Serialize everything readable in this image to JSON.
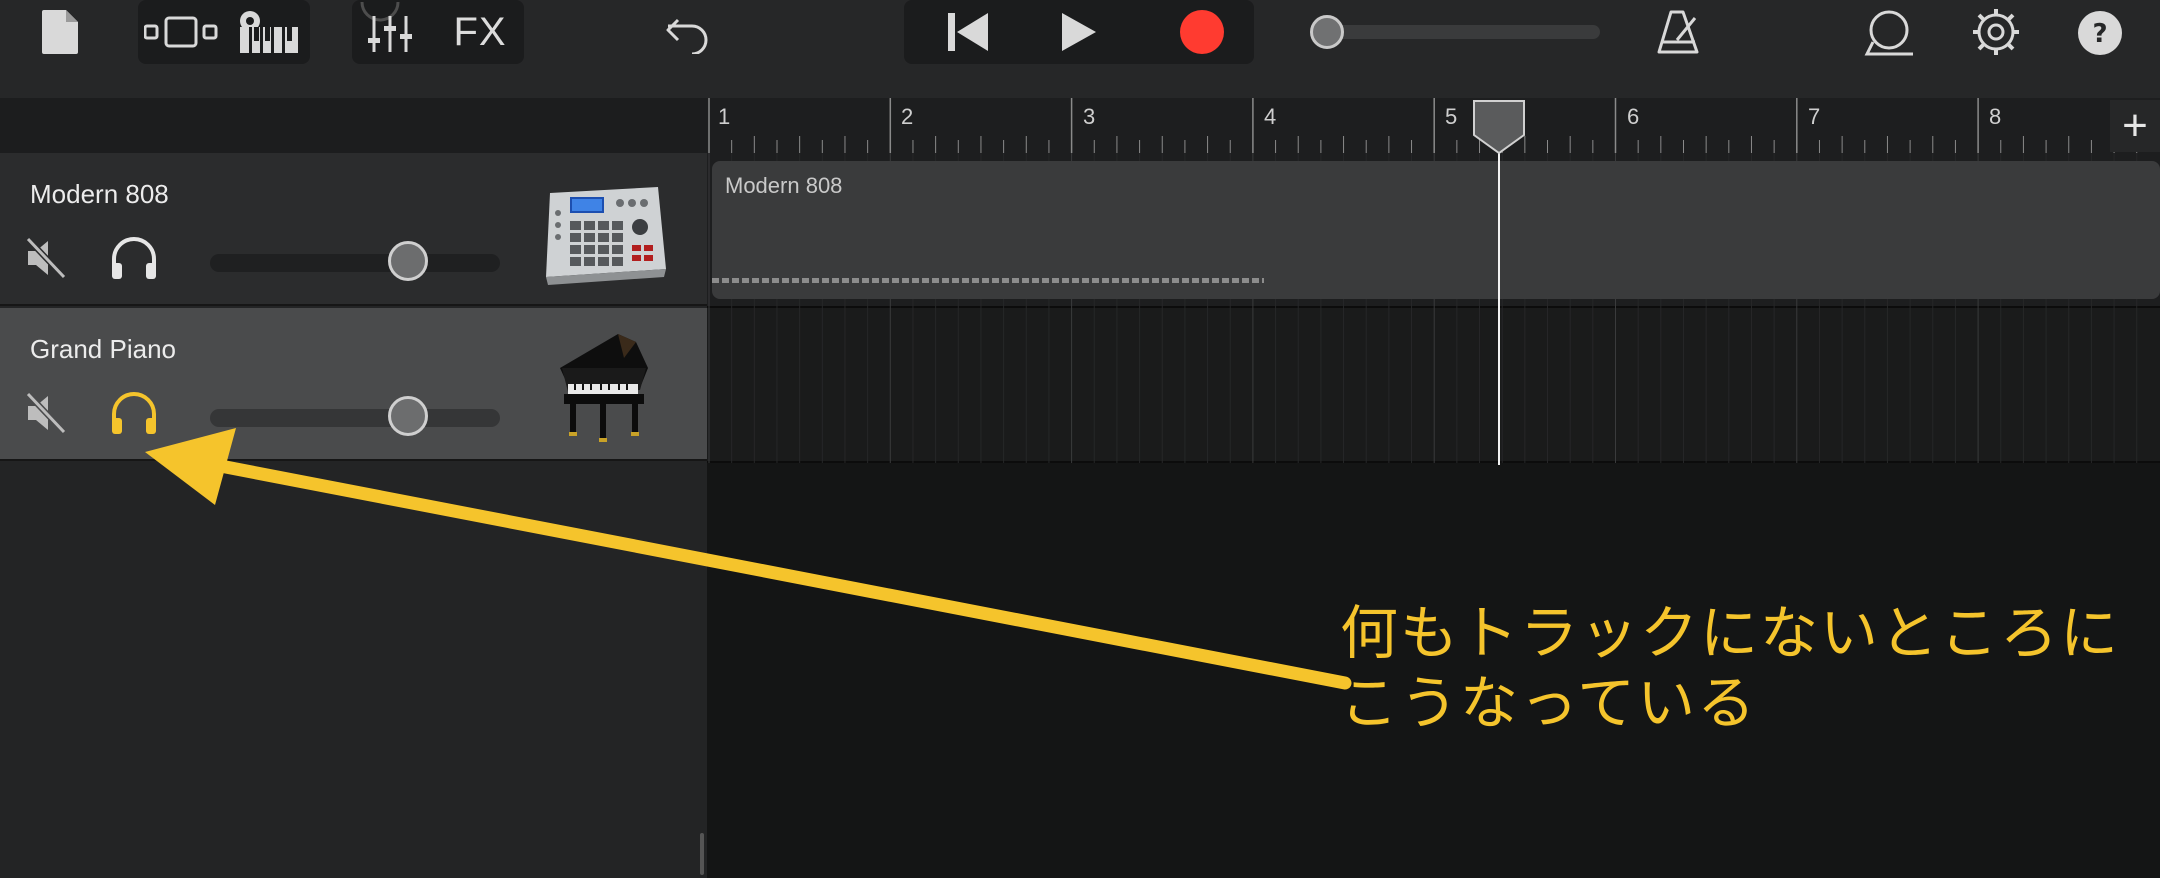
{
  "toolbar": {
    "fx_label": "FX",
    "icons": [
      "document-icon",
      "track-view-icon",
      "instrument-keys-icon",
      "mixer-icon",
      "undo-icon",
      "rewind-icon",
      "play-icon",
      "record-icon",
      "metronome-icon",
      "loop-browser-icon",
      "settings-icon",
      "help-icon"
    ]
  },
  "ruler": {
    "bars": [
      "1",
      "2",
      "3",
      "4",
      "5",
      "6",
      "7",
      "8"
    ],
    "add_label": "+"
  },
  "tracks": [
    {
      "name": "Modern 808",
      "instrument": "drum-machine",
      "solo": false,
      "mute": false,
      "volume": 0.69
    },
    {
      "name": "Grand Piano",
      "instrument": "grand-piano",
      "solo": true,
      "mute": false,
      "volume": 0.69
    }
  ],
  "region": {
    "label": "Modern 808"
  },
  "playhead": {
    "bar": 5.37
  },
  "annotation": {
    "line1": "何もトラックにないところに",
    "line2": "こうなっている"
  },
  "colors": {
    "accent_yellow": "#f5c42c",
    "record_red": "#ff3b30",
    "background": "#141515"
  }
}
